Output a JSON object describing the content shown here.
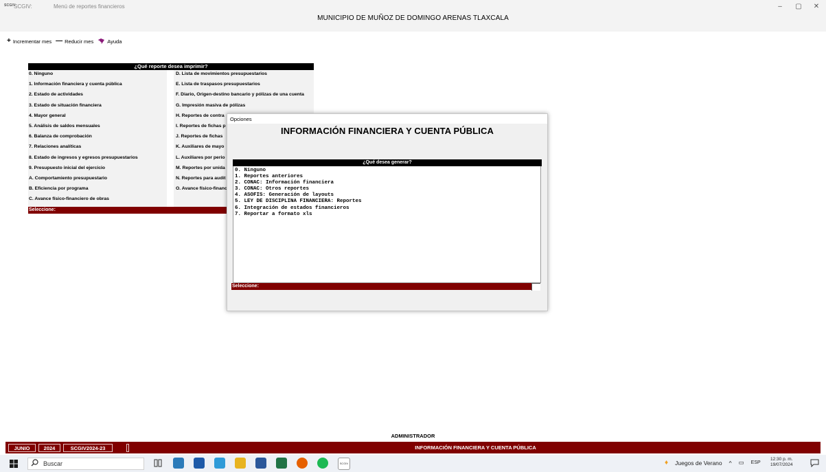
{
  "window": {
    "app_icon_text": "SCGIV",
    "app_name": "SCGIV:",
    "title": "Menú de reportes financieros",
    "controls": {
      "minimize": "–",
      "restore": "▢",
      "close": "✕"
    }
  },
  "header": {
    "municipality": "MUNICIPIO DE MUÑOZ DE DOMINGO ARENAS TLAXCALA"
  },
  "toolbar": {
    "increment": {
      "icon": "+",
      "label": "Incrementar mes"
    },
    "decrement": {
      "icon": "—",
      "label": "Reducir mes"
    },
    "help": {
      "icon": "book-icon",
      "label": "Ayuda"
    }
  },
  "menu": {
    "header": "¿Qué reporte desea imprimir?",
    "left_items": [
      "0. Ninguno",
      "1. Información financiera y cuenta pública",
      "2. Estado de actividades",
      "3. Estado de situación financiera",
      "4. Mayor general",
      "5. Análisis de saldos mensuales",
      "6. Balanza de comprobación",
      "7. Relaciones analíticas",
      "8. Estado de ingresos y egresos presupuestarios",
      "9. Presupuesto inicial del ejercicio",
      "A. Comportamiento presupuestario",
      "B. Eficiencia por programa",
      "C. Avance físico-financiero de obras"
    ],
    "right_items": [
      "D. Lista de movimientos presupuestarios",
      "E. Lista de traspasos presupuestarios",
      "F. Diario, Origen-destino bancario y pólizas de una cuenta",
      "G. Impresión masiva de pólizas",
      "H. Reportes de contra",
      "I. Reportes de fichas p",
      "J. Reportes de fichas",
      "K. Auxiliares de mayo",
      "L. Auxiliares por perio",
      "M. Reportes por unida",
      "N. Reportes para audit",
      "O. Avance físico-financ"
    ],
    "prompt": "Seleccione:"
  },
  "dialog": {
    "title": "Opciones",
    "heading": "INFORMACIÓN FINANCIERA Y CUENTA PÚBLICA",
    "list_header": "¿Qué desea generar?",
    "items": [
      "0. Ninguno",
      "1. Reportes anteriores",
      "2. CONAC: Información financiera",
      "3. CONAC: Otros reportes",
      "4. ASOFIS: Generación de layouts",
      "5. LEY DE DISCIPLINA FINANCIERA: Reportes",
      "6. Integración de estados financieros",
      "7. Reportar a formato xls"
    ],
    "prompt": "Seleccione:"
  },
  "footer": {
    "user": "ADMINISTRADOR",
    "month": "JUNIO",
    "year": "2024",
    "database": "SCGIV2024-23",
    "current_report": "INFORMACIÓN FINANCIERA Y CUENTA PÚBLICA"
  },
  "taskbar": {
    "search_placeholder": "Buscar",
    "weather": "Juegos de Verano",
    "language": "ESP",
    "time": "12:30 p. m.",
    "date": "19/07/2024",
    "scgiv_label": "SCGIV"
  },
  "colors": {
    "accent": "#800000",
    "header_black": "#000000"
  }
}
